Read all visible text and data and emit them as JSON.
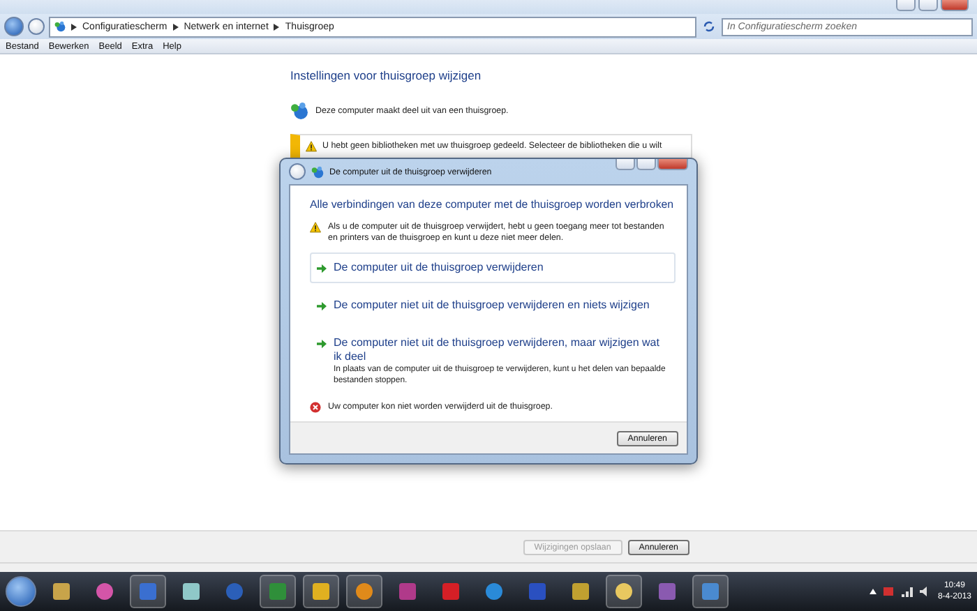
{
  "address_bar": {
    "breadcrumbs": [
      "Configuratiescherm",
      "Netwerk en internet",
      "Thuisgroep"
    ]
  },
  "search": {
    "placeholder": "In Configuratiescherm zoeken"
  },
  "menu": [
    "Bestand",
    "Bewerken",
    "Beeld",
    "Extra",
    "Help"
  ],
  "page": {
    "title": "Instellingen voor thuisgroep wijzigen",
    "status": "Deze computer maakt deel uit van een thuisgroep.",
    "warning": "U hebt geen bibliotheken met uw thuisgroep gedeeld. Selecteer de bibliotheken die u wilt"
  },
  "dialog": {
    "title": "De computer uit de thuisgroep verwijderen",
    "heading": "Alle verbindingen van deze computer met de thuisgroep worden verbroken",
    "warning": "Als u de computer uit de thuisgroep verwijdert, hebt u geen toegang meer tot bestanden en printers van de thuisgroep en kunt u deze niet meer delen.",
    "options": [
      {
        "label": "De computer uit de thuisgroep verwijderen",
        "selected": true
      },
      {
        "label": "De computer niet uit de thuisgroep verwijderen en niets wijzigen",
        "selected": false
      },
      {
        "label": "De computer niet uit de thuisgroep verwijderen, maar wijzigen wat ik deel",
        "description": "In plaats van de computer uit de thuisgroep te verwijderen, kunt u het delen van bepaalde bestanden stoppen.",
        "selected": false
      }
    ],
    "error": "Uw computer kon niet worden verwijderd uit de thuisgroep.",
    "cancel": "Annuleren"
  },
  "buttons": [
    {
      "label": "Wijzigingen opslaan",
      "disabled": true
    },
    {
      "label": "Annuleren",
      "disabled": false
    }
  ],
  "clock": {
    "time": "10:49",
    "date": "8-4-2013"
  }
}
